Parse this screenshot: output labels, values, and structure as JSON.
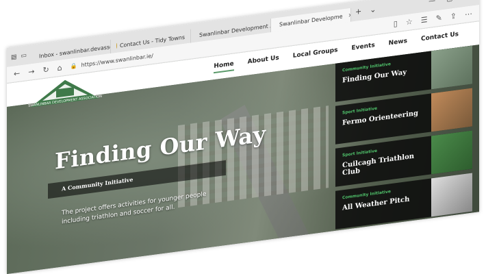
{
  "browser": {
    "tabs": [
      {
        "label": "Inbox - swanlinbar.devassoc",
        "icon": "gmail-icon"
      },
      {
        "label": "Contact Us - Tidy Towns",
        "icon": "tidy-towns-icon"
      },
      {
        "label": "Swanlinbar Development A",
        "icon": "page-icon"
      },
      {
        "label": "Swanlinbar Developme",
        "icon": "swanlinbar-icon",
        "active": true
      }
    ],
    "new_tab_label": "+",
    "dropdown_label": "⌄",
    "url": "https://www.swanlinbar.ie/"
  },
  "site": {
    "nav": [
      {
        "label": "Home",
        "active": true
      },
      {
        "label": "About Us"
      },
      {
        "label": "Local Groups"
      },
      {
        "label": "Events"
      },
      {
        "label": "News"
      },
      {
        "label": "Contact Us"
      }
    ],
    "logo_text": "SWANLINBAR DEVELOPMENT ASSOCIATION",
    "hero": {
      "title": "Finding Our Way",
      "subtitle": "A Community Initiative",
      "description": "The project offers activities for younger people including triathlon and soccer for all."
    },
    "cards": [
      {
        "label": "Community Initiative",
        "title": "Finding Our Way"
      },
      {
        "label": "Sport Initiative",
        "title": "Fermo Orienteering"
      },
      {
        "label": "Sport Initiative",
        "title": "Cuilcagh Triathlon Club"
      },
      {
        "label": "Community Initiative",
        "title": "All Weather Pitch"
      }
    ]
  },
  "colors": {
    "accent": "#4fc06a",
    "nav_underline": "#5a9a6a",
    "card_bg": "#0a0a0a"
  }
}
